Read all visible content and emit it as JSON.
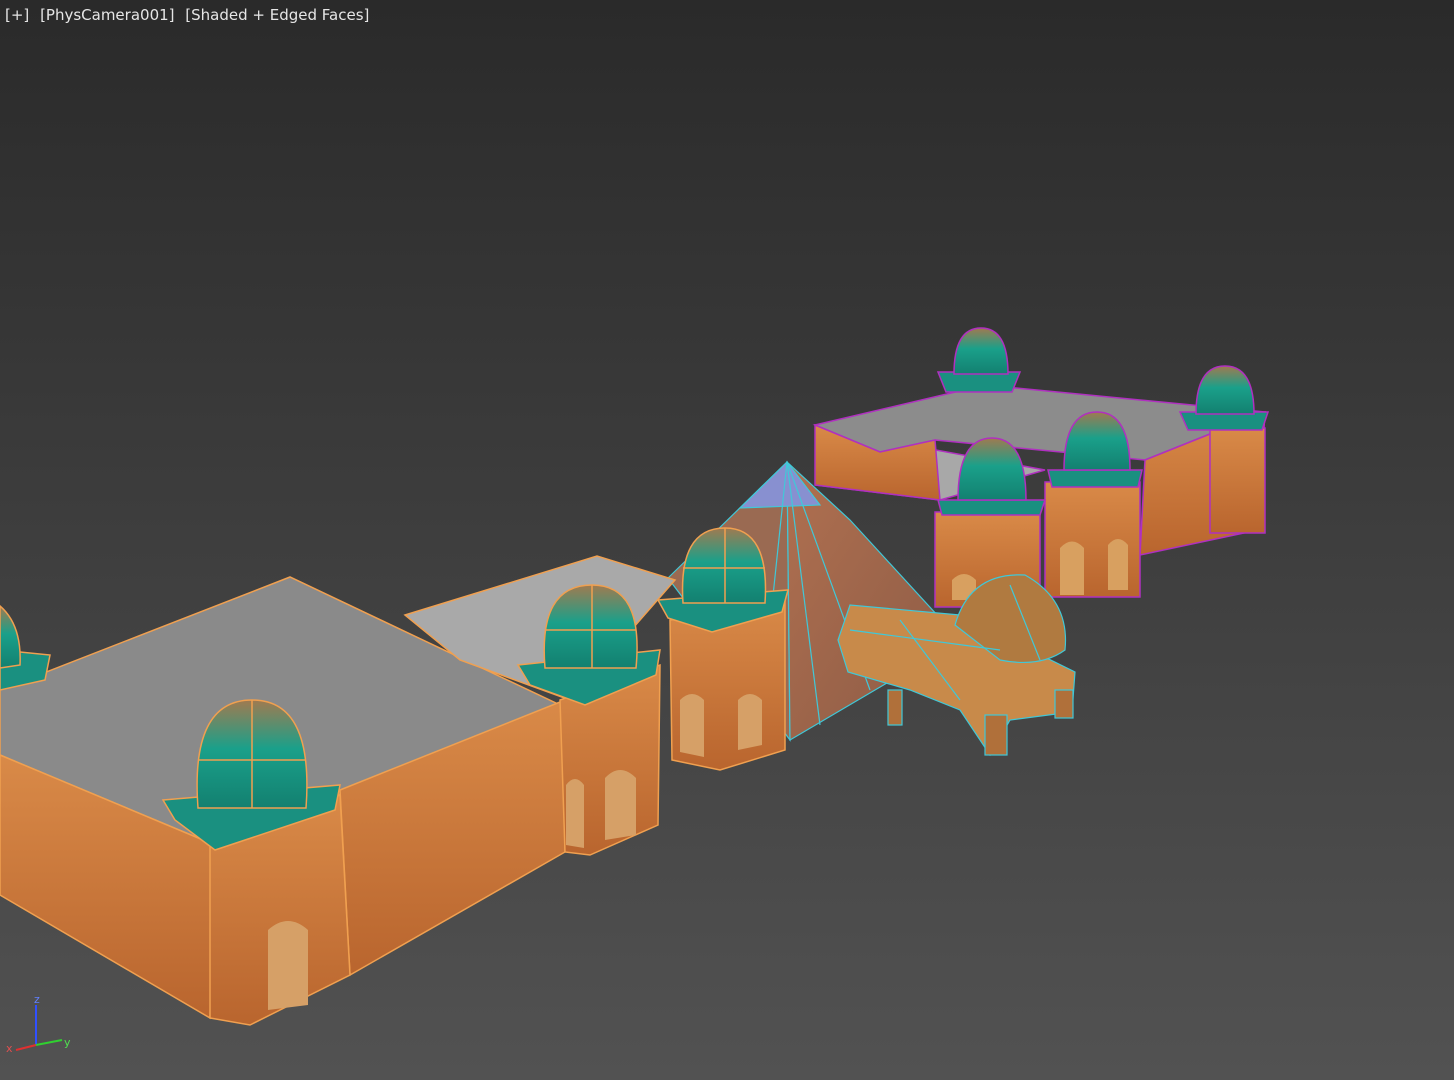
{
  "viewport": {
    "labels": {
      "plus": "[+]",
      "camera": "[PhysCamera001]",
      "shading": "[Shaded + Edged Faces]"
    },
    "axis": {
      "x": "x",
      "y": "y",
      "z": "z"
    }
  },
  "colors": {
    "bg_top": "#2b2b2b",
    "bg_bottom": "#4f4f4f",
    "selection_orange": "#f0a050",
    "selection_purple": "#b030c0",
    "selection_cyan": "#40c8d8",
    "wall": "#c9743a",
    "roof": "#8a8a8a",
    "dome_teal": "#1aa08a"
  }
}
